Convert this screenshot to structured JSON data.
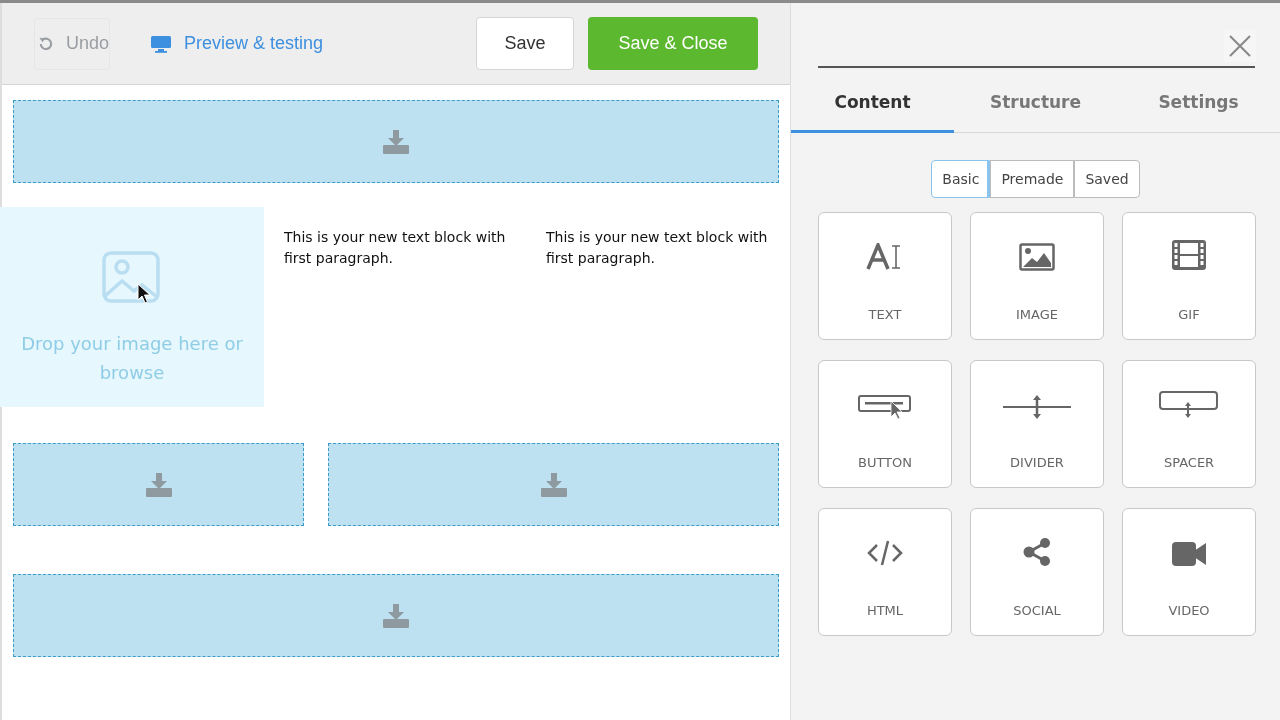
{
  "toolbar": {
    "undo": {
      "label": "Undo",
      "disabled": true
    },
    "preview": {
      "label": "Preview & testing"
    },
    "save": {
      "label": "Save"
    },
    "save_close": {
      "label": "Save & Close"
    }
  },
  "canvas": {
    "image_drop": {
      "label": "Drop your image here or browse"
    },
    "text_blocks": [
      "This is your new text block with first paragraph.",
      "This is your new text block with first paragraph."
    ]
  },
  "panel": {
    "tabs": [
      {
        "label": "Content",
        "selected": true
      },
      {
        "label": "Structure",
        "selected": false
      },
      {
        "label": "Settings",
        "selected": false
      }
    ],
    "segments": [
      {
        "label": "Basic",
        "selected": true
      },
      {
        "label": "Premade",
        "selected": false
      },
      {
        "label": "Saved",
        "selected": false
      }
    ],
    "blocks": [
      {
        "kind": "text",
        "label": "TEXT"
      },
      {
        "kind": "image",
        "label": "IMAGE"
      },
      {
        "kind": "gif",
        "label": "GIF"
      },
      {
        "kind": "button",
        "label": "BUTTON"
      },
      {
        "kind": "divider",
        "label": "DIVIDER"
      },
      {
        "kind": "spacer",
        "label": "SPACER"
      },
      {
        "kind": "html",
        "label": "HTML"
      },
      {
        "kind": "social",
        "label": "SOCIAL"
      },
      {
        "kind": "video",
        "label": "VIDEO"
      }
    ]
  }
}
